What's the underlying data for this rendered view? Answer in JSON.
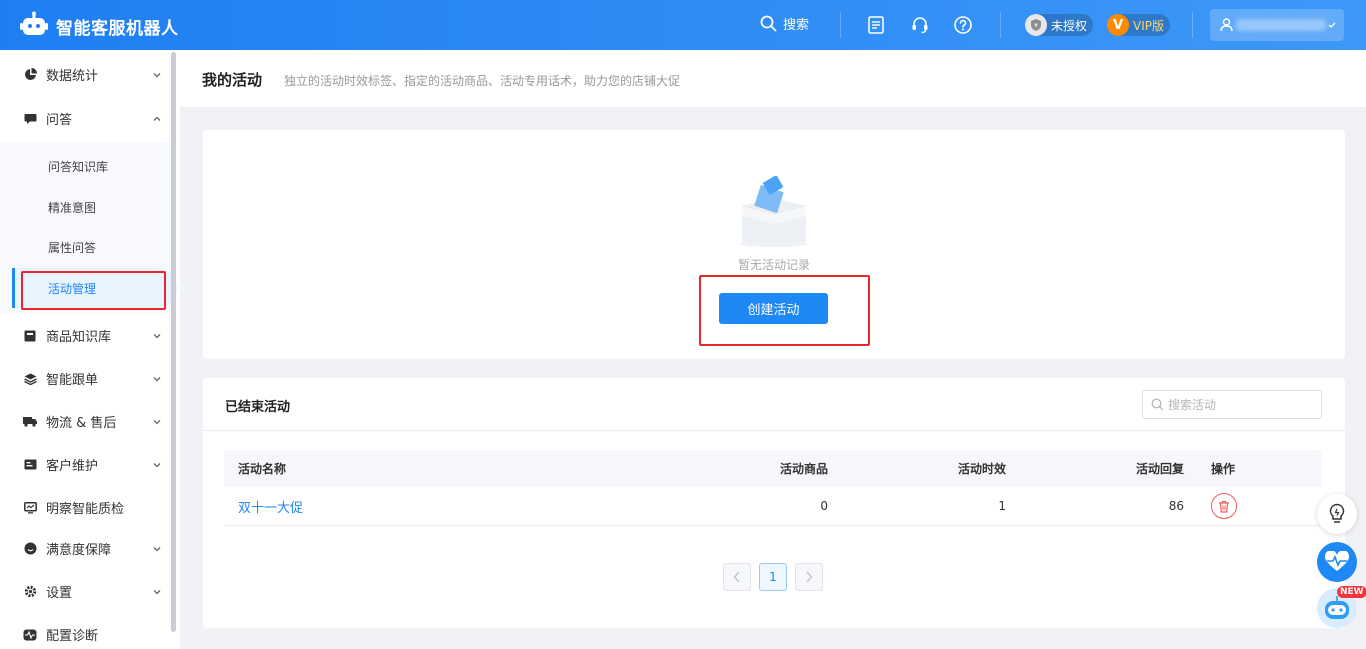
{
  "header": {
    "app_title": "智能客服机器人",
    "search_label": "搜索",
    "auth_badge": "未授权",
    "vip_badge": "VIP版",
    "vip_letter": "V"
  },
  "sidebar": {
    "items": [
      {
        "label": "数据统计",
        "icon": "pie-chart-icon",
        "expanded": false
      },
      {
        "label": "问答",
        "icon": "chat-icon",
        "expanded": true
      },
      {
        "label": "商品知识库",
        "icon": "product-icon",
        "expanded": false
      },
      {
        "label": "智能跟单",
        "icon": "layers-icon",
        "expanded": false
      },
      {
        "label": "物流 & 售后",
        "icon": "truck-icon",
        "expanded": false
      },
      {
        "label": "客户维护",
        "icon": "id-card-icon",
        "expanded": false
      },
      {
        "label": "明察智能质检",
        "icon": "monitor-icon",
        "expanded": false
      },
      {
        "label": "满意度保障",
        "icon": "smile-icon",
        "expanded": false
      },
      {
        "label": "设置",
        "icon": "gear-icon",
        "expanded": false
      },
      {
        "label": "配置诊断",
        "icon": "pulse-icon",
        "expanded": false
      }
    ],
    "sub_items": [
      {
        "label": "问答知识库"
      },
      {
        "label": "精准意图"
      },
      {
        "label": "属性问答"
      },
      {
        "label": "活动管理",
        "active": true
      }
    ]
  },
  "page": {
    "title": "我的活动",
    "description": "独立的活动时效标签、指定的活动商品、活动专用话术，助力您的店铺大促"
  },
  "empty_state": {
    "text": "暂无活动记录",
    "create_button": "创建活动"
  },
  "ended": {
    "title": "已结束活动",
    "search_placeholder": "搜索活动",
    "columns": {
      "name": "活动名称",
      "products": "活动商品",
      "duration": "活动时效",
      "replies": "活动回复",
      "actions": "操作"
    },
    "rows": [
      {
        "name": "双十一大促",
        "products": "0",
        "duration": "1",
        "replies": "86"
      }
    ],
    "pagination": {
      "current_page": "1"
    }
  },
  "floating": {
    "new_badge": "NEW"
  },
  "colors": {
    "primary": "#1e88f5",
    "highlight_box": "#e7272b",
    "danger": "#f0595d"
  }
}
